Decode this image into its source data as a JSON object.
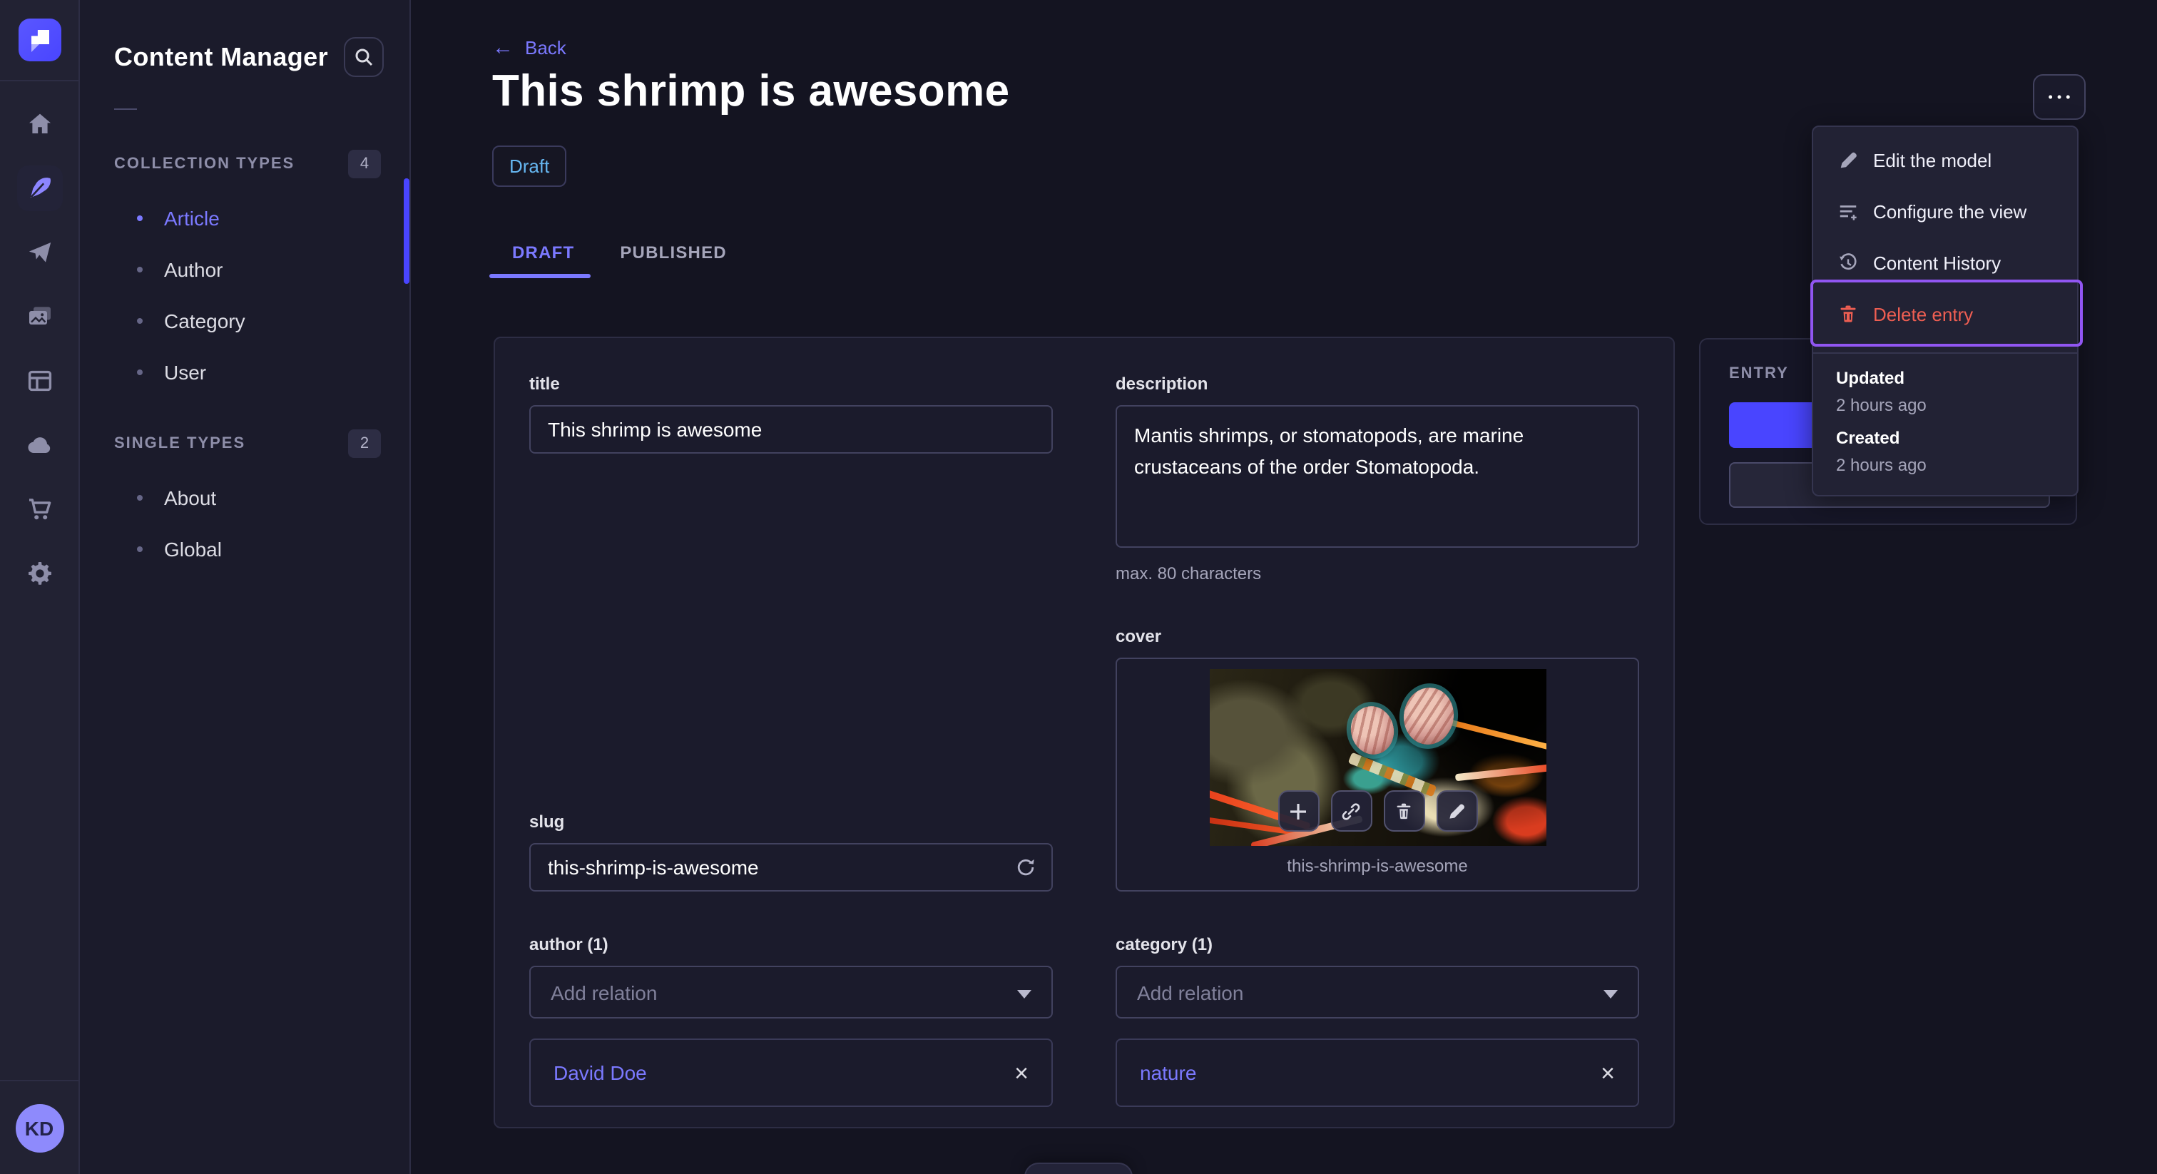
{
  "colors": {
    "accent": "#4945ff",
    "accent_light": "#7b79ff",
    "danger": "#ee5e52",
    "draft_text": "#66b7f1",
    "annotation": "#9156f2"
  },
  "nav": {
    "avatar_initials": "KD",
    "items": [
      {
        "icon": "home-icon"
      },
      {
        "icon": "feather-icon",
        "active": true
      },
      {
        "icon": "paper-plane-icon"
      },
      {
        "icon": "media-library-icon"
      },
      {
        "icon": "content-type-builder-icon"
      },
      {
        "icon": "cloud-icon"
      },
      {
        "icon": "marketplace-cart-icon"
      },
      {
        "icon": "settings-gear-icon"
      }
    ]
  },
  "subnav": {
    "title": "Content Manager",
    "collection_types_label": "COLLECTION TYPES",
    "collection_types_count": "4",
    "single_types_label": "SINGLE TYPES",
    "single_types_count": "2",
    "items_collection": [
      {
        "label": "Article",
        "active": true
      },
      {
        "label": "Author"
      },
      {
        "label": "Category"
      },
      {
        "label": "User"
      }
    ],
    "items_single": [
      {
        "label": "About"
      },
      {
        "label": "Global"
      }
    ]
  },
  "header": {
    "back_label": "Back",
    "back_arrow": "←",
    "title": "This shrimp is awesome",
    "status_badge": "Draft",
    "more_label": "•••",
    "tab_draft": "DRAFT",
    "tab_published": "PUBLISHED"
  },
  "form": {
    "title_label": "title",
    "title_value": "This shrimp is awesome",
    "description_label": "description",
    "description_value": "Mantis shrimps, or stomatopods, are marine crustaceans of the order Stomatopoda.",
    "description_helper": "max. 80 characters",
    "slug_label": "slug",
    "slug_value": "this-shrimp-is-awesome",
    "cover_label": "cover",
    "cover_caption": "this-shrimp-is-awesome",
    "author_label": "author (1)",
    "author_placeholder": "Add relation",
    "author_relation": "David Doe",
    "category_label": "category (1)",
    "category_placeholder": "Add relation",
    "category_relation": "nature",
    "remove_symbol": "×"
  },
  "entry_panel": {
    "label": "ENTRY"
  },
  "menu": {
    "edit_model": "Edit the model",
    "configure_view": "Configure the view",
    "content_history": "Content History",
    "delete_entry": "Delete entry",
    "updated_label": "Updated",
    "updated_value": "2 hours ago",
    "created_label": "Created",
    "created_value": "2 hours ago"
  }
}
